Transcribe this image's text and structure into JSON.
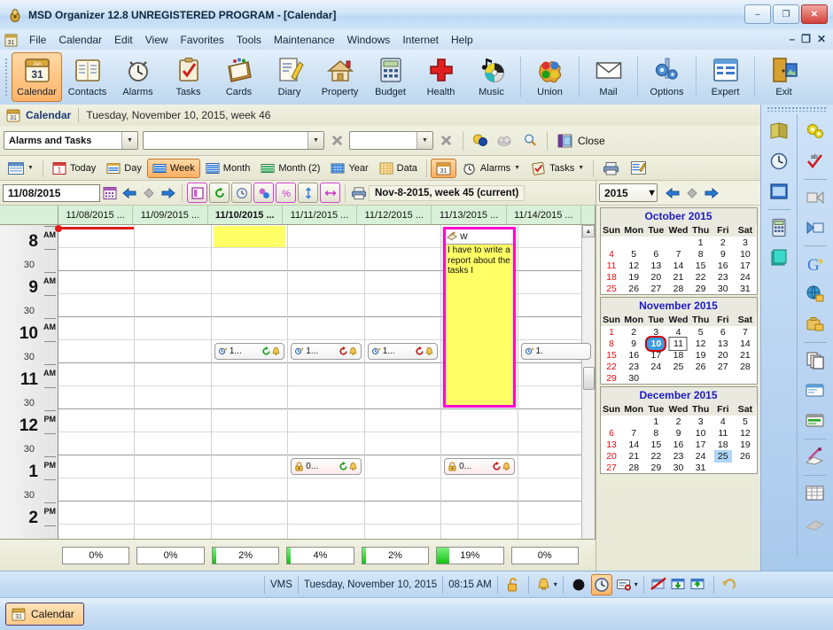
{
  "window": {
    "title": "MSD Organizer 12.8 UNREGISTERED PROGRAM - [Calendar]",
    "icon": "organizer-icon",
    "minimize": "–",
    "maximize": "❐",
    "close": "✕"
  },
  "menubar": {
    "doc_icon": "document-icon",
    "items": [
      "File",
      "Calendar",
      "Edit",
      "View",
      "Favorites",
      "Tools",
      "Maintenance",
      "Windows",
      "Internet",
      "Help"
    ],
    "mdi": [
      "–",
      "❐",
      "✕"
    ]
  },
  "toolbar": {
    "buttons": [
      {
        "label": "Calendar",
        "icon": "calendar-icon",
        "selected": true
      },
      {
        "label": "Contacts",
        "icon": "contacts-icon",
        "selected": false
      },
      {
        "label": "Alarms",
        "icon": "alarm-clock-icon",
        "selected": false
      },
      {
        "label": "Tasks",
        "icon": "clipboard-check-icon",
        "selected": false
      },
      {
        "label": "Cards",
        "icon": "card-file-icon",
        "selected": false
      },
      {
        "label": "Diary",
        "icon": "diary-pencil-icon",
        "selected": false
      },
      {
        "label": "Property",
        "icon": "house-icon",
        "selected": false
      },
      {
        "label": "Budget",
        "icon": "calculator-icon",
        "selected": false
      },
      {
        "label": "Health",
        "icon": "red-cross-icon",
        "selected": false
      },
      {
        "label": "Music",
        "icon": "music-cd-icon",
        "selected": false
      },
      {
        "label": "Union",
        "icon": "puzzle-icon",
        "selected": false
      },
      {
        "label": "Mail",
        "icon": "envelope-icon",
        "selected": false
      },
      {
        "label": "Options",
        "icon": "gears-icon",
        "selected": false
      },
      {
        "label": "Expert",
        "icon": "list-window-icon",
        "selected": false
      },
      {
        "label": "Exit",
        "icon": "exit-door-icon",
        "selected": false
      }
    ]
  },
  "doc_header": {
    "icon": "calendar-31-icon",
    "name": "Calendar",
    "subtitle": "Tuesday, November 10, 2015, week 46"
  },
  "filters": {
    "category_value": "Alarms and Tasks",
    "filter_value": "",
    "filter2_value": "",
    "clear_icon": "clear-x-icon",
    "clear2_icon": "clear-x-icon",
    "balloons_icon": "balloons-icon",
    "cloud_icon": "cloud-icon",
    "search_icon": "magnifier-icon",
    "close_icon": "close-window-icon",
    "close_label": "Close"
  },
  "viewbar": {
    "layout_icon": "layout-icon",
    "items": [
      {
        "label": "Today",
        "icon": "today-icon",
        "selected": false
      },
      {
        "label": "Day",
        "icon": "day-view-icon",
        "selected": false
      },
      {
        "label": "Week",
        "icon": "week-view-icon",
        "selected": true
      },
      {
        "label": "Month",
        "icon": "month-view-icon",
        "selected": false
      },
      {
        "label": "Month (2)",
        "icon": "month2-view-icon",
        "selected": false
      },
      {
        "label": "Year",
        "icon": "year-view-icon",
        "selected": false
      },
      {
        "label": "Data",
        "icon": "data-grid-icon",
        "selected": false
      }
    ],
    "calendar_toggle": {
      "icon": "calendar-panel-icon",
      "selected": true
    },
    "alarms": {
      "label": "Alarms",
      "icon": "alarm-clock-icon"
    },
    "tasks": {
      "label": "Tasks",
      "icon": "tasks-icon"
    },
    "print_icon": "printer-icon",
    "notes_icon": "notes-icon"
  },
  "datenav": {
    "date_value": "11/08/2015",
    "picker_icon": "date-picker-icon",
    "prev_icon": "arrow-left-icon",
    "dot_icon": "diamond-icon",
    "next_icon": "arrow-right-icon",
    "toggles": [
      {
        "icon": "single-pane-icon"
      },
      {
        "icon": "refresh-icon"
      },
      {
        "icon": "clock-icon"
      },
      {
        "icon": "percent-bubble-icon"
      },
      {
        "icon": "percent-icon"
      },
      {
        "icon": "height-icon"
      },
      {
        "icon": "width-icon"
      }
    ],
    "print_icon": "printer-icon",
    "week_label": "Nov-8-2015, week 45 (current)"
  },
  "calendar": {
    "day_headers": [
      {
        "label": "11/08/2015 ...",
        "today": false
      },
      {
        "label": "11/09/2015 ...",
        "today": false
      },
      {
        "label": "11/10/2015 ...",
        "today": true
      },
      {
        "label": "11/11/2015 ...",
        "today": false
      },
      {
        "label": "11/12/2015 ...",
        "today": false
      },
      {
        "label": "11/13/2015 ...",
        "today": false
      },
      {
        "label": "11/14/2015 ...",
        "today": false
      }
    ],
    "time_rows": [
      {
        "hour": "8",
        "ampm": "AM",
        "half": ""
      },
      {
        "hour": "",
        "ampm": "",
        "half": "30"
      },
      {
        "hour": "9",
        "ampm": "AM",
        "half": ""
      },
      {
        "hour": "",
        "ampm": "",
        "half": "30"
      },
      {
        "hour": "10",
        "ampm": "AM",
        "half": ""
      },
      {
        "hour": "",
        "ampm": "",
        "half": "30"
      },
      {
        "hour": "11",
        "ampm": "AM",
        "half": ""
      },
      {
        "hour": "",
        "ampm": "",
        "half": "30"
      },
      {
        "hour": "12",
        "ampm": "PM",
        "half": ""
      },
      {
        "hour": "",
        "ampm": "",
        "half": "30"
      },
      {
        "hour": "1",
        "ampm": "PM",
        "half": ""
      },
      {
        "hour": "",
        "ampm": "",
        "half": "30"
      },
      {
        "hour": "2",
        "ampm": "PM",
        "half": ""
      },
      {
        "hour": "",
        "ampm": "",
        "half": ""
      }
    ],
    "events": [
      {
        "col": 2,
        "row": 5,
        "text": "1...",
        "icon": "alarm-whistle-icon",
        "repeat_icon": "repeat-green-icon",
        "bell_icon": "bell-icon",
        "style": "white"
      },
      {
        "col": 3,
        "row": 5,
        "text": "1...",
        "icon": "alarm-whistle-icon",
        "repeat_icon": "repeat-red-icon",
        "bell_icon": "bell-icon",
        "style": "white"
      },
      {
        "col": 4,
        "row": 5,
        "text": "1...",
        "icon": "alarm-whistle-icon",
        "repeat_icon": "repeat-red-icon",
        "bell_icon": "bell-icon",
        "style": "white"
      },
      {
        "col": 6,
        "row": 5,
        "text": "1.",
        "icon": "alarm-whistle-icon",
        "repeat_icon": "",
        "bell_icon": "",
        "style": "white"
      },
      {
        "col": 3,
        "row": 10,
        "text": "0...",
        "icon": "padlock-icon",
        "repeat_icon": "repeat-green-icon",
        "bell_icon": "bell-icon",
        "style": "pink"
      },
      {
        "col": 5,
        "row": 10,
        "text": "0...",
        "icon": "padlock-icon",
        "repeat_icon": "repeat-red-icon",
        "bell_icon": "bell-icon",
        "style": "pink"
      }
    ],
    "selected_block": {
      "col": 2,
      "row": 0,
      "label": ""
    },
    "big_event": {
      "col": 5,
      "header_icon": "task-hand-icon",
      "header_text": "W",
      "body": "I have to write a report about the tasks I"
    },
    "now_marker": {
      "row": 0,
      "color": "#e01b1b"
    },
    "percent_row": [
      "0%",
      "0%",
      "2%",
      "4%",
      "2%",
      "19%",
      "0%"
    ],
    "percent_values": [
      0,
      0,
      2,
      4,
      2,
      19,
      0
    ]
  },
  "mini_calendars": {
    "year_value": "2015",
    "prev_icon": "arrow-left-icon",
    "dot_icon": "diamond-icon",
    "next_icon": "arrow-right-icon",
    "dow": [
      "Sun",
      "Mon",
      "Tue",
      "Wed",
      "Thu",
      "Fri",
      "Sat"
    ],
    "months": [
      {
        "title": "October 2015",
        "weeks": [
          [
            "",
            "",
            "",
            "",
            "1",
            "2",
            "3"
          ],
          [
            "4",
            "5",
            "6",
            "7",
            "8",
            "9",
            "10"
          ],
          [
            "11",
            "12",
            "13",
            "14",
            "15",
            "16",
            "17"
          ],
          [
            "18",
            "19",
            "20",
            "21",
            "22",
            "23",
            "24"
          ],
          [
            "25",
            "26",
            "27",
            "28",
            "29",
            "30",
            "31"
          ]
        ],
        "selected": "",
        "boxed": "",
        "highlighted": ""
      },
      {
        "title": "November 2015",
        "weeks": [
          [
            "1",
            "2",
            "3",
            "4",
            "5",
            "6",
            "7"
          ],
          [
            "8",
            "9",
            "10",
            "11",
            "12",
            "13",
            "14"
          ],
          [
            "15",
            "16",
            "17",
            "18",
            "19",
            "20",
            "21"
          ],
          [
            "22",
            "23",
            "24",
            "25",
            "26",
            "27",
            "28"
          ],
          [
            "29",
            "30",
            "",
            "",
            "",
            "",
            ""
          ]
        ],
        "selected": "10",
        "boxed": "11",
        "highlighted": ""
      },
      {
        "title": "December 2015",
        "weeks": [
          [
            "",
            "",
            "1",
            "2",
            "3",
            "4",
            "5"
          ],
          [
            "6",
            "7",
            "8",
            "9",
            "10",
            "11",
            "12"
          ],
          [
            "13",
            "14",
            "15",
            "16",
            "17",
            "18",
            "19"
          ],
          [
            "20",
            "21",
            "22",
            "23",
            "24",
            "25",
            "26"
          ],
          [
            "27",
            "28",
            "29",
            "30",
            "31",
            "",
            ""
          ]
        ],
        "selected": "",
        "boxed": "",
        "highlighted": "25"
      }
    ]
  },
  "rail": {
    "left_icons": [
      "book-icon",
      "clock-icon",
      "blue-window-icon",
      "calculator-icon",
      "notes-stack-icon"
    ],
    "right_icons": [
      "gears-icon",
      "spellcheck-icon",
      "import-icon",
      "export-icon",
      "google-icon",
      "globe-lock-icon",
      "briefcase-lock-icon",
      "copy-pages-icon",
      "window-blue-icon",
      "green-bar-icon",
      "signature-icon",
      "table-grid-icon",
      "disabled-icon"
    ]
  },
  "statusbar": {
    "db_label": "VMS",
    "date": "Tuesday, November 10, 2015",
    "time": "08:15 AM",
    "lock_icon": "open-padlock-icon",
    "bell_icon": "bell-icon",
    "bell_arrow": "▾",
    "circle_icon": "black-circle-icon",
    "clock_icon": "clock-icon",
    "clock_selected": true,
    "card_icon": "card-delete-icon",
    "card_arrow": "▾",
    "no_alarm_icon": "no-alarm-icon",
    "import_icon": "import-window-icon",
    "export_icon": "export-window-icon",
    "undo_icon": "undo-arrow-icon"
  },
  "taskbar": {
    "item_icon": "calendar-31-icon",
    "item_label": "Calendar"
  },
  "colors": {
    "accent": "#ff00d0",
    "selected": "#ffb469",
    "event_yellow": "#ffff66",
    "now_red": "#e01b1b",
    "progress_green": "#13c413",
    "header_green": "#d8f0d8"
  }
}
